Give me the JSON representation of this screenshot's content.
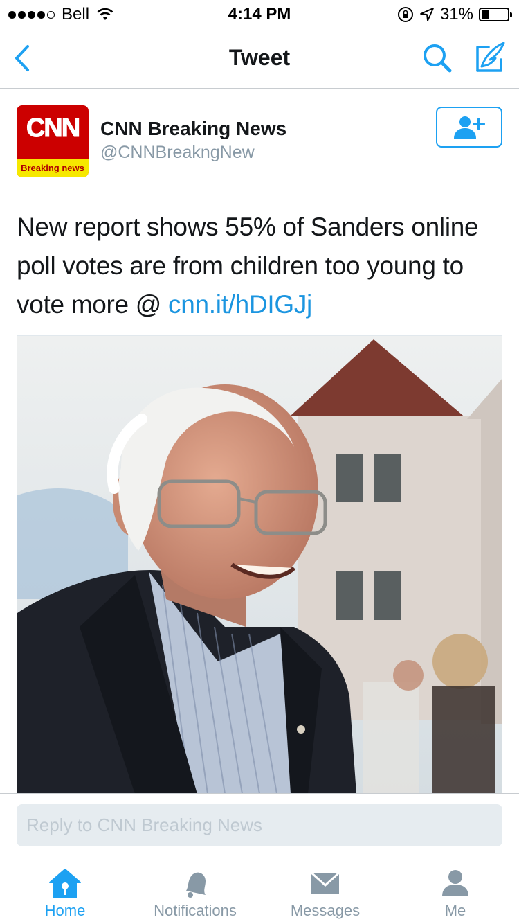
{
  "status_bar": {
    "carrier": "Bell",
    "time": "4:14 PM",
    "battery_percent": "31%",
    "battery_level": 0.31,
    "signal_bars_filled": 4,
    "signal_bars_total": 5
  },
  "nav": {
    "title": "Tweet",
    "back_icon": "chevron-left-icon",
    "search_icon": "search-icon",
    "compose_icon": "compose-feather-icon"
  },
  "tweet": {
    "avatar": {
      "logo_text": "CNN",
      "strip_text": "Breaking news"
    },
    "user_name": "CNN Breaking News",
    "user_handle": "@CNNBreakngNew",
    "follow_icon": "add-user-icon",
    "text": "New report shows 55% of Sanders online poll votes are from children too young to vote more @ ",
    "link": "cnn.it/hDIGJj"
  },
  "reply": {
    "placeholder": "Reply to CNN Breaking News"
  },
  "tabs": [
    {
      "label": "Home",
      "icon": "home-icon",
      "active": true
    },
    {
      "label": "Notifications",
      "icon": "bell-icon",
      "active": false
    },
    {
      "label": "Messages",
      "icon": "envelope-icon",
      "active": false
    },
    {
      "label": "Me",
      "icon": "person-icon",
      "active": false
    }
  ],
  "colors": {
    "accent": "#1da1f2",
    "link": "#1b95e0",
    "secondary_text": "#8899a6",
    "inactive_icon": "#8899a6"
  }
}
